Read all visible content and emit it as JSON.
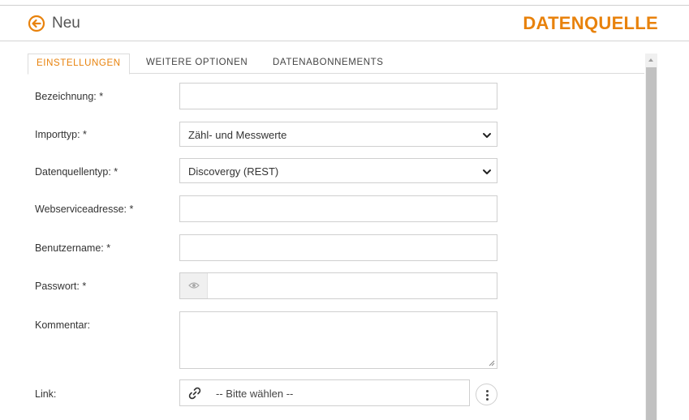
{
  "header": {
    "back_icon": "arrow-left-circle-icon",
    "title": "Neu",
    "app_title": "DATENQUELLE",
    "accent_color": "#e8820c"
  },
  "tabs": [
    {
      "label": "EINSTELLUNGEN",
      "active": true
    },
    {
      "label": "WEITERE OPTIONEN",
      "active": false
    },
    {
      "label": "DATENABONNEMENTS",
      "active": false
    }
  ],
  "form": {
    "bezeichnung": {
      "label": "Bezeichnung: *",
      "value": ""
    },
    "importtyp": {
      "label": "Importtyp: *",
      "value": "Zähl- und Messwerte"
    },
    "datenquellentyp": {
      "label": "Datenquellentyp: *",
      "value": "Discovergy (REST)"
    },
    "webserviceadresse": {
      "label": "Webserviceadresse: *",
      "value": ""
    },
    "benutzername": {
      "label": "Benutzername: *",
      "value": ""
    },
    "passwort": {
      "label": "Passwort: *",
      "value": "",
      "icon": "eye-icon"
    },
    "kommentar": {
      "label": "Kommentar:",
      "value": ""
    },
    "link": {
      "label": "Link:",
      "value": "-- Bitte wählen --",
      "icon": "link-icon",
      "menu_icon": "more-vertical-icon"
    }
  }
}
